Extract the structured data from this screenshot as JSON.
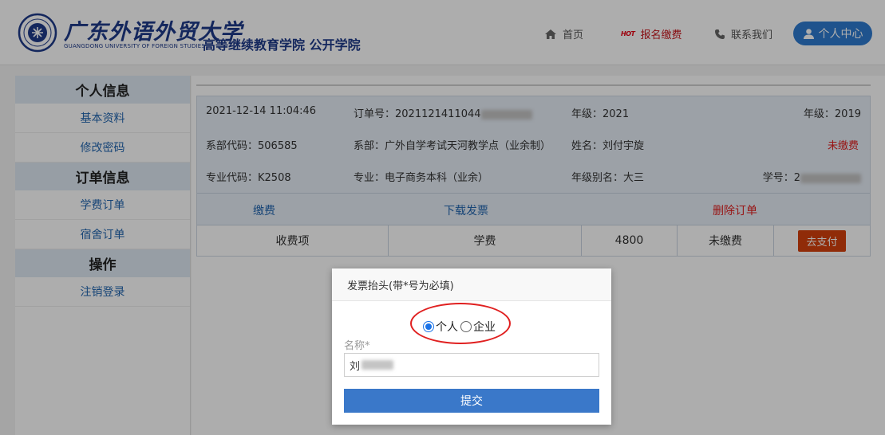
{
  "header": {
    "school_name_cn": "广东外语外贸大学",
    "school_name_en": "GUANGDONG UNIVERSITY OF FOREIGN STUDIES",
    "college_name": "高等继续教育学院 公开学院",
    "nav": {
      "home": "首页",
      "apply_badge": "HOT",
      "apply": "报名缴费",
      "contact": "联系我们",
      "user_center": "个人中心"
    }
  },
  "sidebar": {
    "sections": [
      {
        "title": "个人信息",
        "items": [
          "基本资料",
          "修改密码"
        ]
      },
      {
        "title": "订单信息",
        "items": [
          "学费订单",
          "宿舍订单"
        ]
      },
      {
        "title": "操作",
        "items": [
          "注销登录"
        ]
      }
    ]
  },
  "order": {
    "datetime": "2021-12-14 11:04:46",
    "order_no_label": "订单号：",
    "order_no": "2021121411044",
    "grade_label": "年级：",
    "grade": "2021",
    "grade2_label": "年级：",
    "grade2": "2019",
    "dept_code_label": "系部代码：",
    "dept_code": "506585",
    "dept_label": "系部：",
    "dept": "广外自学考试天河教学点（业余制）",
    "name_label": "姓名：",
    "name": "刘付宇旋",
    "pay_status": "未缴费",
    "major_code_label": "专业代码：",
    "major_code": "K2508",
    "major_label": "专业：",
    "major": "电子商务本科（业余）",
    "grade_alias_label": "年级别名：",
    "grade_alias": "大三",
    "student_no_label": "学号：",
    "student_no": "2",
    "actions": {
      "pay": "缴费",
      "download_invoice": "下载发票",
      "delete_order": "删除订单"
    },
    "fee_row": {
      "item_label": "收费项",
      "item": "学费",
      "amount": "4800",
      "status": "未缴费",
      "pay_button": "去支付"
    }
  },
  "invoice_modal": {
    "title": "发票抬头(带*号为必填)",
    "options": [
      "个人",
      "企业"
    ],
    "selected": "个人",
    "name_label": "名称*",
    "name_value": "刘",
    "submit": "提交"
  },
  "colors": {
    "primary": "#2e7bd0",
    "brand": "#1e3a8a",
    "alert_red": "#e02020",
    "pay_orange": "#d4400c",
    "card_bg": "#e6edf6"
  }
}
